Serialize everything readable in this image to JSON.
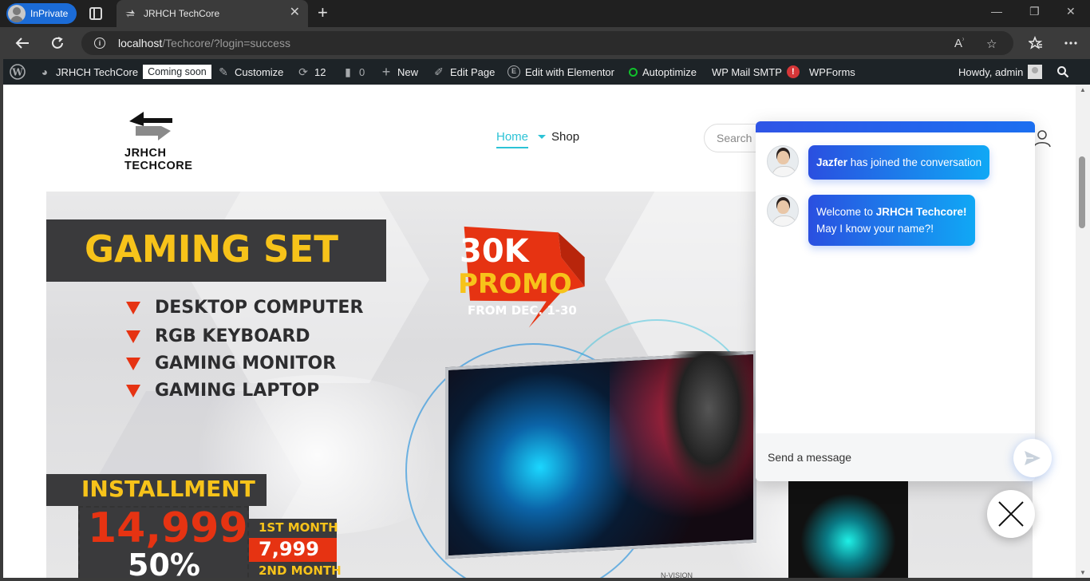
{
  "browser": {
    "profile_label": "InPrivate",
    "tab_title": "JRHCH TechCore",
    "tab_close": "✕",
    "new_tab": "+",
    "url_host": "localhost",
    "url_path": "/Techcore/?login=success",
    "window_controls": {
      "minimize": "—",
      "restore": "❐",
      "close": "✕"
    }
  },
  "adminbar": {
    "site_name": "JRHCH TechCore",
    "coming_soon": "Coming soon",
    "customize": "Customize",
    "updates_count": "12",
    "comments_count": "0",
    "new": "New",
    "edit_page": "Edit Page",
    "elementor": "Edit with Elementor",
    "autoptimize": "Autoptimize",
    "wp_mail_smtp": "WP Mail SMTP",
    "smtp_alert": "!",
    "wpforms": "WPForms",
    "howdy": "Howdy, admin"
  },
  "site": {
    "logo_text": "JRHCH TECHCORE",
    "nav": {
      "home": "Home",
      "shop": "Shop"
    },
    "search_placeholder": "Search"
  },
  "banner": {
    "title": "GAMING SET",
    "features": [
      "DESKTOP COMPUTER",
      "RGB KEYBOARD",
      "GAMING MONITOR",
      "GAMING LAPTOP"
    ],
    "promo_amount": "30K",
    "promo_word": "PROMO",
    "promo_dates": "FROM DEC. 1-30",
    "installment_label": "INSTALLMENT",
    "price": "14,999",
    "percent": "50%",
    "first_month_label": "1ST MONTH",
    "first_month_amount": "7,999",
    "second_month_label": "2ND MONTH",
    "monitor_brand": "N-VISION"
  },
  "chat": {
    "messages": [
      {
        "sender_name": "Jazfer",
        "text": " has joined the conversation"
      },
      {
        "line1_prefix": "Welcome to ",
        "line1_brand": "JRHCH Techcore!",
        "line2": "May I know your name?!"
      }
    ],
    "input_placeholder": "Send a message"
  },
  "colors": {
    "accent": "#2cc3d6",
    "adminbar_bg": "#1d2327",
    "chat_gradient_start": "#2a4fe0",
    "chat_gradient_end": "#10a8f5",
    "banner_yellow": "#f7c31a",
    "banner_red": "#e63312"
  }
}
